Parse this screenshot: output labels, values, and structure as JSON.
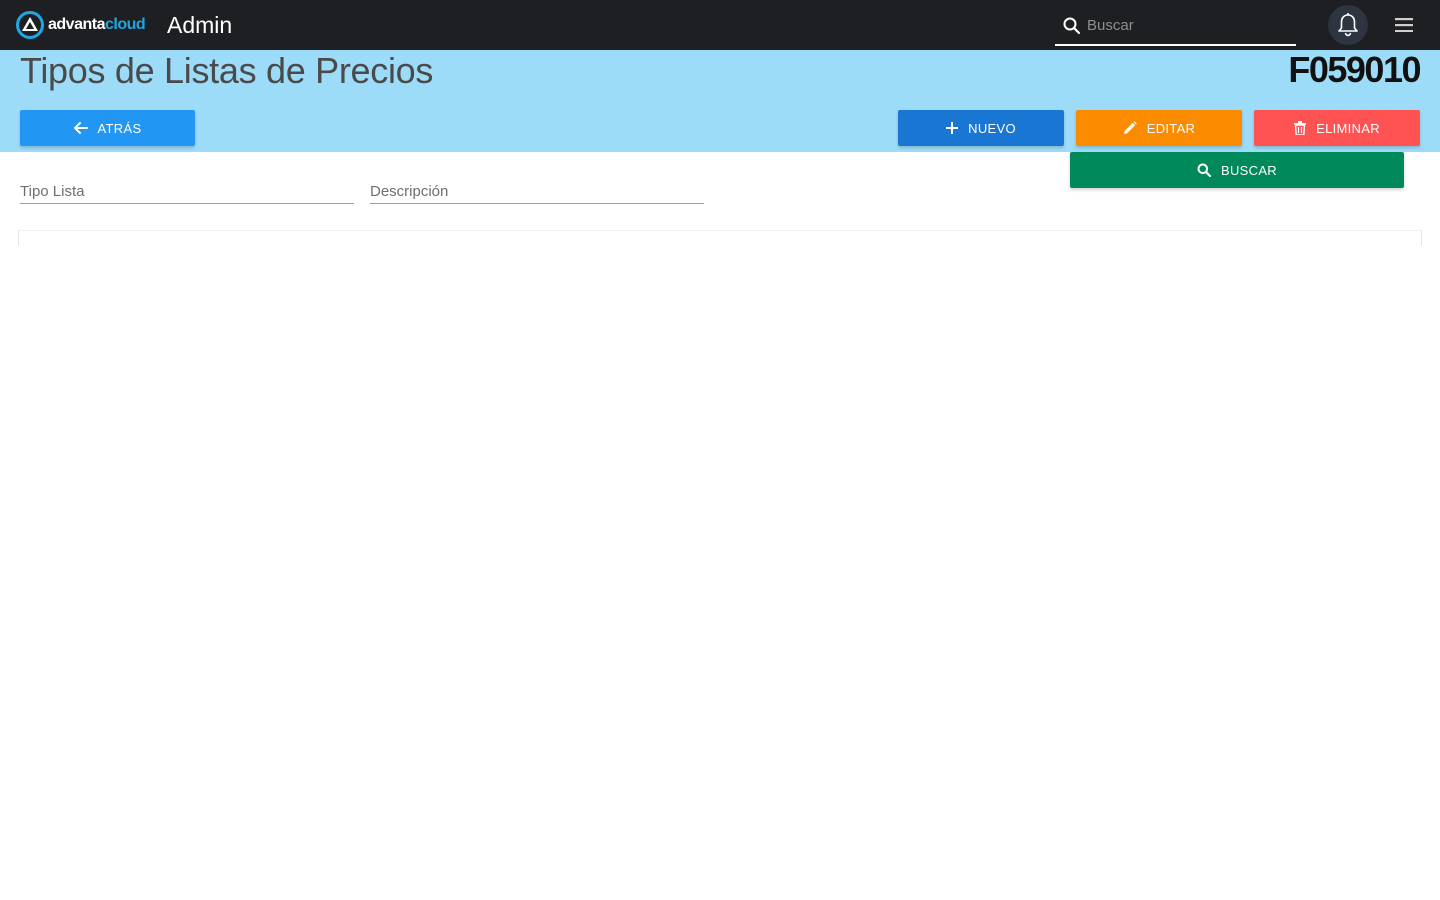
{
  "topbar": {
    "logo_text_a": "advanta",
    "logo_text_b": "cloud",
    "app_title": "Admin",
    "search_placeholder": "Buscar",
    "icons": [
      "search-icon",
      "bell-icon",
      "hamburger-menu-icon"
    ]
  },
  "header": {
    "title": "Tipos de Listas de Precios",
    "form_code": "F059010",
    "background": "#9ddcf9"
  },
  "actions": {
    "back_label": "ATRÁS",
    "new_label": "NUEVO",
    "edit_label": "EDITAR",
    "delete_label": "ELIMINAR",
    "search_label": "BUSCAR"
  },
  "filters": {
    "tipo_lista_placeholder": "Tipo Lista",
    "descripcion_placeholder": "Descripción"
  },
  "colors": {
    "back": "#2196f3",
    "new": "#1976d2",
    "edit": "#fb8c00",
    "delete": "#ff5252",
    "search": "#00895a"
  }
}
